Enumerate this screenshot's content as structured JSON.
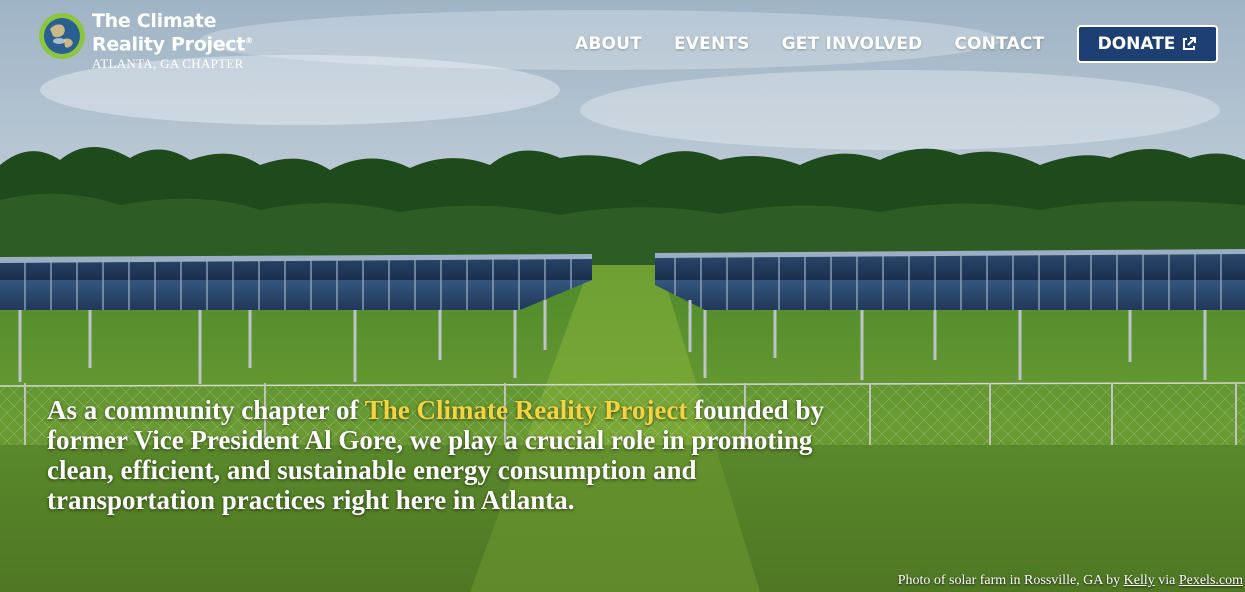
{
  "logo": {
    "name_line1": "The Climate",
    "name_line2": "Reality Project",
    "trademark": "®",
    "chapter": "ATLANTA, GA CHAPTER",
    "icon": "globe-icon"
  },
  "nav": {
    "items": [
      {
        "label": "ABOUT"
      },
      {
        "label": "EVENTS"
      },
      {
        "label": "GET INVOLVED"
      },
      {
        "label": "CONTACT"
      }
    ],
    "donate_label": "DONATE",
    "donate_icon": "external-link-icon"
  },
  "hero": {
    "blurb_before": "As a community chapter of ",
    "blurb_highlight": "The Climate Reality Project",
    "blurb_after": " founded by former Vice President Al Gore, we play a crucial role in promoting clean, efficient, and sustainable energy consumption and transportation practices right here in Atlanta.",
    "credit_prefix": "Photo of solar farm in Rossville, GA by ",
    "credit_author": "Kelly",
    "credit_via": " via ",
    "credit_source": "Pexels.com"
  },
  "colors": {
    "donate_bg": "#1d3f73",
    "highlight": "#f5d442",
    "globe_ring": "#8cc63f"
  }
}
